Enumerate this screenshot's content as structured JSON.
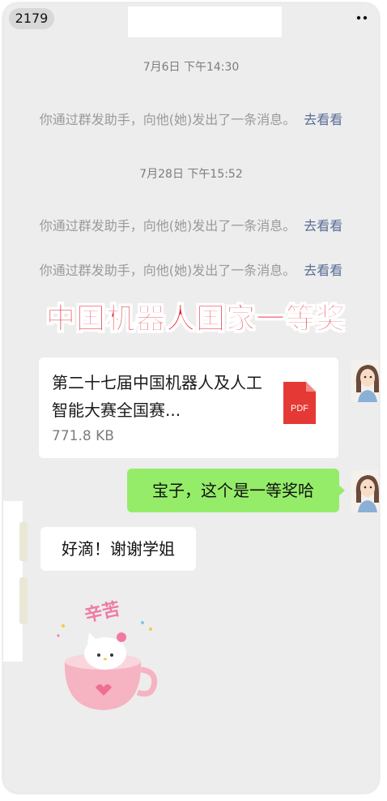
{
  "header": {
    "unread_count": "2179",
    "more_icon": "more-icon"
  },
  "messages": {
    "time1": "7月6日 下午14:30",
    "sys1_text": "你通过群发助手，向他(她)发出了一条消息。",
    "sys1_link": "去看看",
    "time2": "7月28日 下午15:52",
    "sys2_text": "你通过群发助手，向他(她)发出了一条消息。",
    "sys2_link": "去看看",
    "sys3_text": "你通过群发助手，向他(她)发出了一条消息。",
    "sys3_link": "去看看"
  },
  "banner": {
    "text": "中国机器人国家一等奖"
  },
  "file": {
    "name": "第二十七届中国机器人及人工智能大赛全国赛...",
    "size": "771.8 KB",
    "type_label": "PDF"
  },
  "chat": {
    "sent_text": "宝子，这个是一等奖哈",
    "received_text": "好滴！谢谢学姐"
  },
  "sticker": {
    "caption": "辛苦"
  },
  "colors": {
    "green_bubble": "#95ec69",
    "banner_red": "#e01a2b",
    "link_blue": "#5a6d95",
    "chat_bg": "#ededed",
    "pdf_red": "#e53935"
  }
}
